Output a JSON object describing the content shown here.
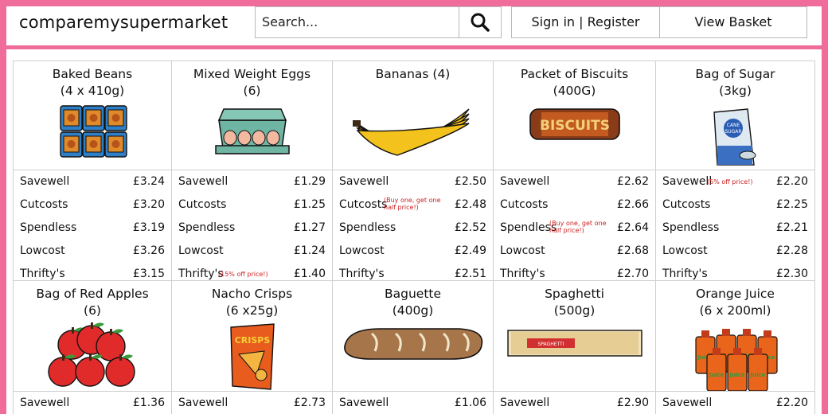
{
  "header": {
    "brand": "comparemysupermarket",
    "search_placeholder": "Search...",
    "sign_in_label": "Sign in | Register",
    "basket_label": "View Basket"
  },
  "products": [
    {
      "title": "Baked Beans\n(4 x 410g)",
      "prices": [
        {
          "store": "Savewell",
          "price": "£3.24",
          "note": ""
        },
        {
          "store": "Cutcosts",
          "price": "£3.20",
          "note": ""
        },
        {
          "store": "Spendless",
          "price": "£3.19",
          "note": ""
        },
        {
          "store": "Lowcost",
          "price": "£3.26",
          "note": ""
        },
        {
          "store": "Thrifty's",
          "price": "£3.15",
          "note": ""
        }
      ]
    },
    {
      "title": "Mixed Weight Eggs\n(6)",
      "prices": [
        {
          "store": "Savewell",
          "price": "£1.29",
          "note": ""
        },
        {
          "store": "Cutcosts",
          "price": "£1.25",
          "note": ""
        },
        {
          "store": "Spendless",
          "price": "£1.27",
          "note": ""
        },
        {
          "store": "Lowcost",
          "price": "£1.24",
          "note": ""
        },
        {
          "store": "Thrifty's",
          "price": "£1.40",
          "note": "(15% off price!)"
        }
      ]
    },
    {
      "title": "Bananas (4)",
      "prices": [
        {
          "store": "Savewell",
          "price": "£2.50",
          "note": ""
        },
        {
          "store": "Cutcosts",
          "price": "£2.48",
          "note": "(Buy one, get one half price!)"
        },
        {
          "store": "Spendless",
          "price": "£2.52",
          "note": ""
        },
        {
          "store": "Lowcost",
          "price": "£2.49",
          "note": ""
        },
        {
          "store": "Thrifty's",
          "price": "£2.51",
          "note": ""
        }
      ]
    },
    {
      "title": "Packet of Biscuits\n(400G)",
      "prices": [
        {
          "store": "Savewell",
          "price": "£2.62",
          "note": ""
        },
        {
          "store": "Cutcosts",
          "price": "£2.66",
          "note": ""
        },
        {
          "store": "Spendless",
          "price": "£2.64",
          "note": "(Buy one, get one half price!)"
        },
        {
          "store": "Lowcost",
          "price": "£2.68",
          "note": ""
        },
        {
          "store": "Thrifty's",
          "price": "£2.70",
          "note": ""
        }
      ]
    },
    {
      "title": "Bag of Sugar\n(3kg)",
      "image_text": "CANE SUGAR",
      "prices": [
        {
          "store": "Savewell",
          "price": "£2.20",
          "note": "(5% off price!)"
        },
        {
          "store": "Cutcosts",
          "price": "£2.25",
          "note": ""
        },
        {
          "store": "Spendless",
          "price": "£2.21",
          "note": ""
        },
        {
          "store": "Lowcost",
          "price": "£2.28",
          "note": ""
        },
        {
          "store": "Thrifty's",
          "price": "£2.30",
          "note": ""
        }
      ]
    },
    {
      "title": "Bag of Red Apples\n(6)",
      "prices": [
        {
          "store": "Savewell",
          "price": "£1.36",
          "note": ""
        }
      ]
    },
    {
      "title": "Nacho Crisps\n(6 x25g)",
      "image_text": "CRISPS",
      "prices": [
        {
          "store": "Savewell",
          "price": "£2.73",
          "note": ""
        }
      ]
    },
    {
      "title": "Baguette\n(400g)",
      "prices": [
        {
          "store": "Savewell",
          "price": "£1.06",
          "note": ""
        }
      ]
    },
    {
      "title": "Spaghetti\n(500g)",
      "image_text": "SPAGHETTI",
      "prices": [
        {
          "store": "Savewell",
          "price": "£2.90",
          "note": ""
        }
      ]
    },
    {
      "title": "Orange Juice\n(6 x 200ml)",
      "image_text": "Juice",
      "prices": [
        {
          "store": "Savewell",
          "price": "£2.20",
          "note": ""
        }
      ]
    }
  ],
  "colors": {
    "accent": "#f06c9b",
    "note": "#cc1f1f",
    "border": "#cfcfcf"
  }
}
